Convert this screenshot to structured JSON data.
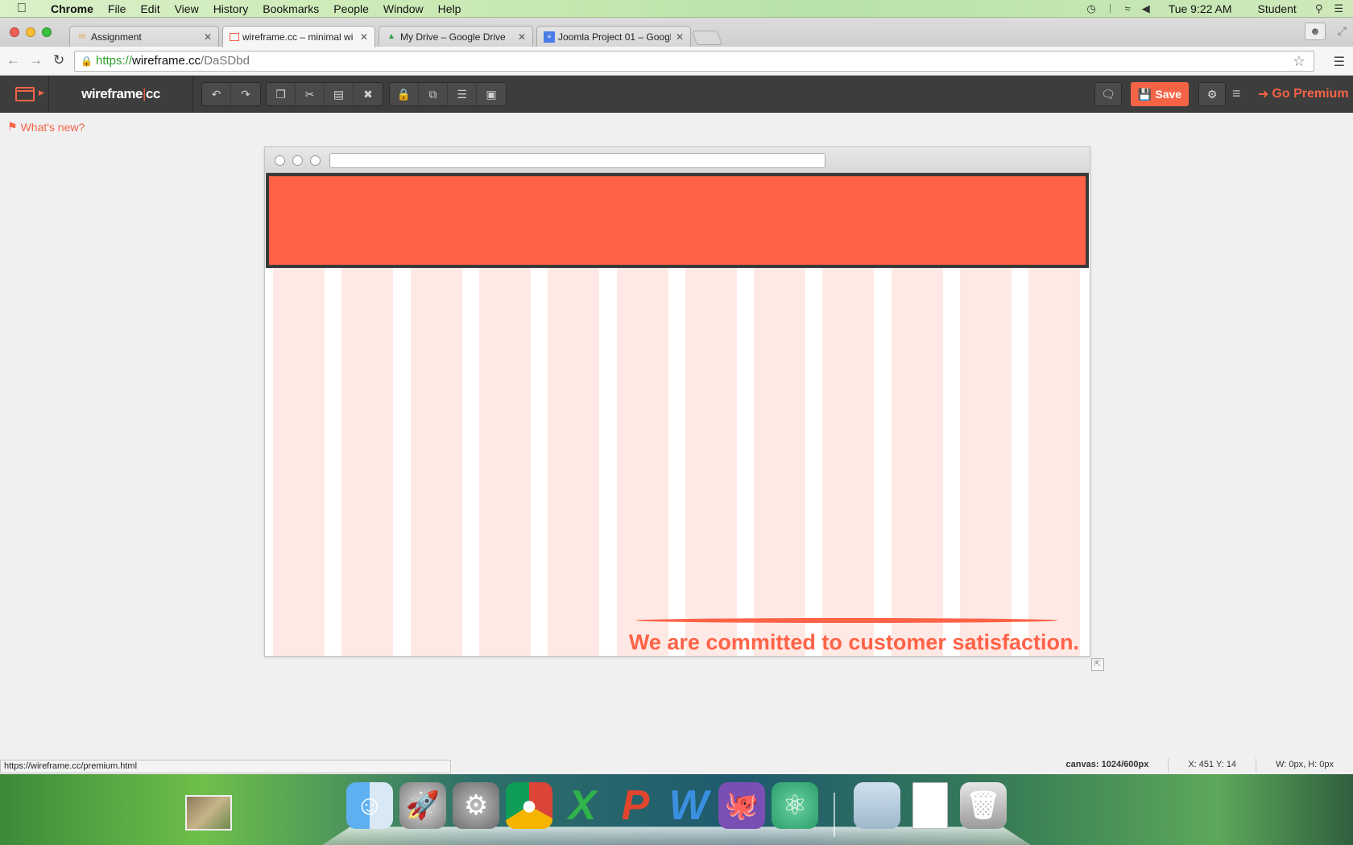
{
  "menubar": {
    "app": "Chrome",
    "items": [
      "File",
      "Edit",
      "View",
      "History",
      "Bookmarks",
      "People",
      "Window",
      "Help"
    ],
    "clock": "Tue 9:22 AM",
    "user": "Student"
  },
  "tabs": [
    {
      "title": "Assignment",
      "icon": "moodle-icon",
      "active": false
    },
    {
      "title": "wireframe.cc – minimal wi",
      "icon": "wireframe-icon",
      "active": true
    },
    {
      "title": "My Drive – Google Drive",
      "icon": "drive-icon",
      "active": false
    },
    {
      "title": "Joomla Project 01 – Google",
      "icon": "docs-icon",
      "active": false
    }
  ],
  "address": {
    "scheme": "https://",
    "host": "wireframe.cc",
    "path": "/DaSDbd"
  },
  "app": {
    "brand_left": "wireframe",
    "brand_sep": "|",
    "brand_right": "cc",
    "save_label": "Save",
    "premium_label": "Go Premium",
    "whats_new": "What's new?"
  },
  "mockup": {
    "tagline": "We are committed to customer satisfaction.",
    "header_color": "#ff6347",
    "accent": "#f56346",
    "grid_columns": 12
  },
  "status": {
    "hover_url": "https://wireframe.cc/premium.html",
    "canvas_label": "canvas:",
    "canvas_value": "1024/600px",
    "coords": "X: 451 Y: 14",
    "dims": "W: 0px, H: 0px"
  },
  "dock": {
    "icons": [
      "finder-icon",
      "launchpad-icon",
      "system-preferences-icon",
      "chrome-icon",
      "excel-icon",
      "powerpoint-icon",
      "word-icon",
      "github-icon",
      "atom-icon",
      "documents-folder-icon",
      "file-icon",
      "trash-icon"
    ]
  }
}
